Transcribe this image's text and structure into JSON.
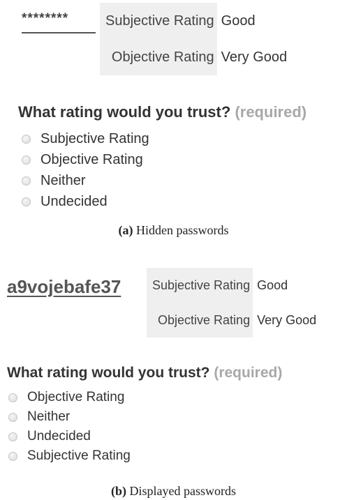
{
  "panel_a": {
    "password": "********",
    "ratings": [
      {
        "label": "Subjective Rating",
        "value": "Good"
      },
      {
        "label": "Objective Rating",
        "value": "Very Good"
      }
    ],
    "question": "What rating would you trust?",
    "required": "(required)",
    "options": [
      "Subjective Rating",
      "Objective Rating",
      "Neither",
      "Undecided"
    ],
    "caption_tag": "(a)",
    "caption_text": "Hidden passwords"
  },
  "panel_b": {
    "password": "a9vojebafe37",
    "ratings": [
      {
        "label": "Subjective Rating",
        "value": "Good"
      },
      {
        "label": "Objective Rating",
        "value": "Very Good"
      }
    ],
    "question": "What rating would you trust?",
    "required": "(required)",
    "options": [
      "Objective Rating",
      "Neither",
      "Undecided",
      "Subjective Rating"
    ],
    "caption_tag": "(b)",
    "caption_text": "Displayed passwords"
  }
}
